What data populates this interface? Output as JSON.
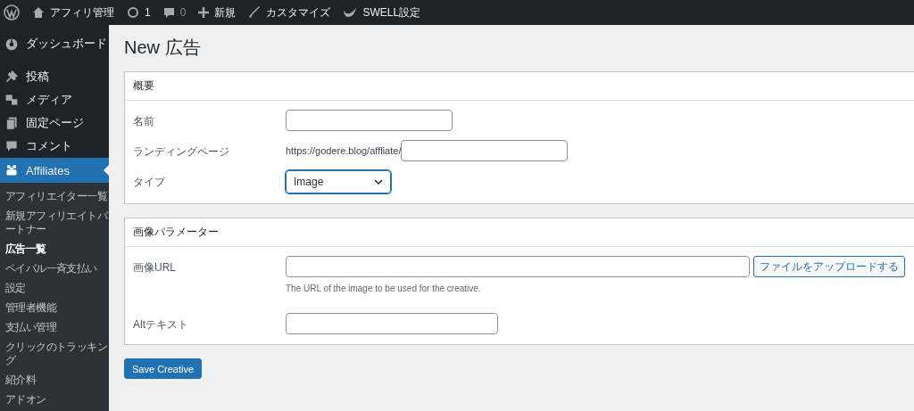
{
  "admin_bar": {
    "site_name": "アフィリ管理",
    "updates": "1",
    "comments": "0",
    "new": "新規",
    "customize": "カスタマイズ",
    "theme_settings": "SWELL設定"
  },
  "sidebar": {
    "items": [
      {
        "label": "ダッシュボード",
        "selected": false
      },
      {
        "label": "投稿",
        "selected": false
      },
      {
        "label": "メディア",
        "selected": false
      },
      {
        "label": "固定ページ",
        "selected": false
      },
      {
        "label": "コメント",
        "selected": false
      },
      {
        "label": "Affiliates",
        "selected": true
      }
    ],
    "submenu": [
      {
        "label": "アフィリエイター一覧",
        "selected": false
      },
      {
        "label": "新規アフィリエイトパートナー",
        "selected": false
      },
      {
        "label": "広告一覧",
        "selected": true
      },
      {
        "label": "ペイパル一斉支払い",
        "selected": false
      },
      {
        "label": "設定",
        "selected": false
      },
      {
        "label": "管理者機能",
        "selected": false
      },
      {
        "label": "支払い管理",
        "selected": false
      },
      {
        "label": "クリックのトラッキング",
        "selected": false
      },
      {
        "label": "紹介料",
        "selected": false
      },
      {
        "label": "アドオン",
        "selected": false
      }
    ]
  },
  "page_title": "New 広告",
  "panels": [
    {
      "title": "概要",
      "fields": [
        {
          "kind": "text",
          "label": "名前"
        },
        {
          "kind": "prefixed",
          "label": "ランディングページ",
          "prefix": "https://godere.blog/affliate/"
        },
        {
          "kind": "select",
          "label": "タイプ",
          "value": "Image"
        }
      ]
    },
    {
      "title": "画像パラメーター",
      "fields": [
        {
          "kind": "upload",
          "label": "画像URL",
          "button": "ファイルをアップロードする",
          "description": "The URL of the image to be used for the creative."
        },
        {
          "kind": "text",
          "label": "Altテキスト"
        }
      ]
    }
  ],
  "save_button": "Save Creative"
}
